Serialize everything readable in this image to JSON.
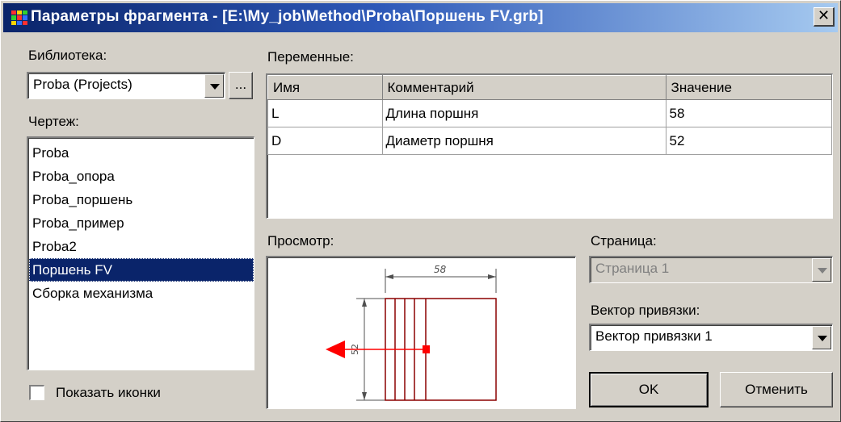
{
  "window": {
    "title": "Параметры фрагмента - [E:\\My_job\\Method\\Proba\\Поршень FV.grb]",
    "close_symbol": "✕"
  },
  "library": {
    "label": "Библиотека:",
    "value": "Proba (Projects)",
    "browse_label": "..."
  },
  "drawing": {
    "label": "Чертеж:",
    "items": [
      "Proba",
      "Proba_опора",
      "Proba_поршень",
      "Proba_пример",
      "Proba2",
      "Поршень FV",
      "Сборка механизма"
    ],
    "selected": "Поршень FV"
  },
  "show_icons": {
    "label": "Показать иконки",
    "checked": false
  },
  "variables": {
    "label": "Переменные:",
    "columns": [
      "Имя",
      "Комментарий",
      "Значение"
    ],
    "rows": [
      {
        "name": "L",
        "comment": "Длина поршня",
        "value": "58"
      },
      {
        "name": "D",
        "comment": "Диаметр поршня",
        "value": "52"
      }
    ]
  },
  "preview": {
    "label": "Просмотр:",
    "dimension_text": "58",
    "colors": {
      "outline": "#8b0000",
      "dimension": "#505050",
      "arrow": "#ff0000"
    }
  },
  "page": {
    "label": "Страница:",
    "value": "Страница 1",
    "enabled": false
  },
  "anchor": {
    "label": "Вектор привязки:",
    "value": "Вектор привязки 1"
  },
  "buttons": {
    "ok": "OK",
    "cancel": "Отменить"
  },
  "icons": {
    "app": "app-grid-icon",
    "close": "close-icon",
    "dropdown": "chevron-down-icon"
  }
}
